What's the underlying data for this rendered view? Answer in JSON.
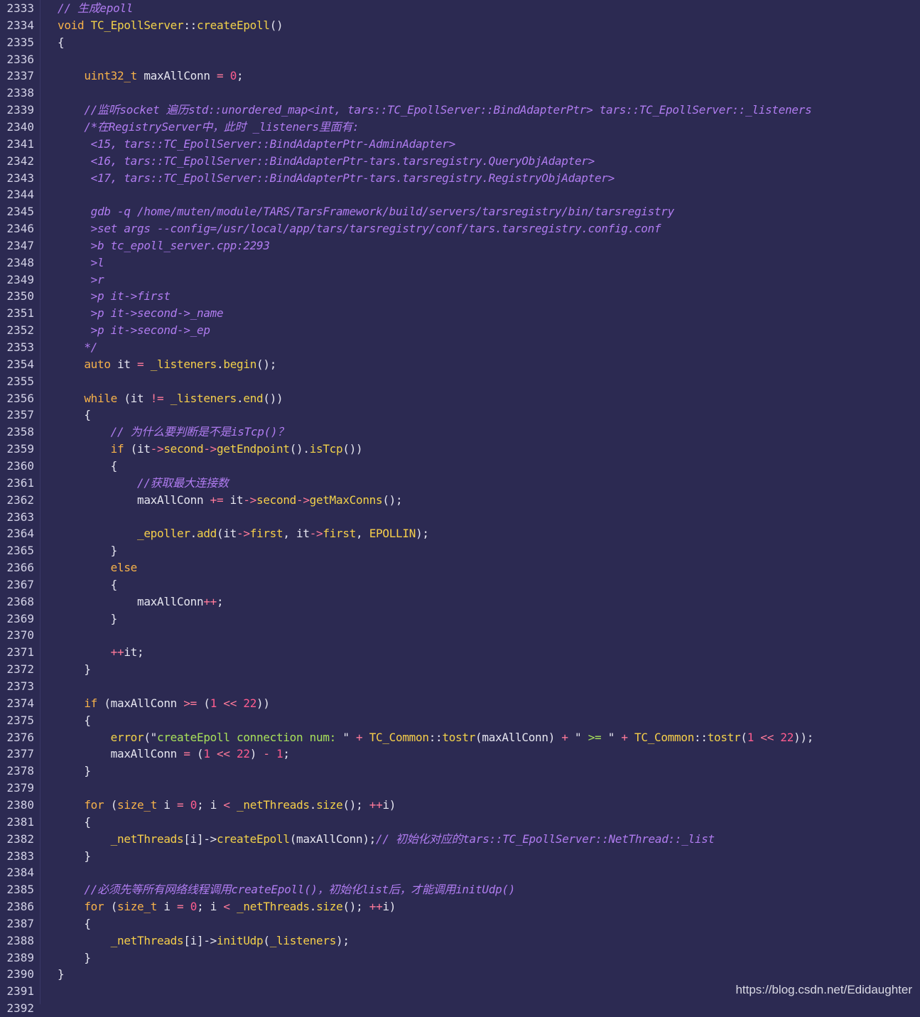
{
  "editor": {
    "lines": [
      {
        "num": "2333",
        "tokens": [
          [
            "cm",
            "// 生成epoll"
          ]
        ]
      },
      {
        "num": "2334",
        "tokens": [
          [
            "kw",
            "void "
          ],
          [
            "fn",
            "TC_EpollServer"
          ],
          [
            "pl",
            "::"
          ],
          [
            "fn",
            "createEpoll"
          ],
          [
            "pl",
            "()"
          ]
        ]
      },
      {
        "num": "2335",
        "tokens": [
          [
            "pl",
            "{"
          ]
        ]
      },
      {
        "num": "2336",
        "tokens": []
      },
      {
        "num": "2337",
        "tokens": [
          [
            "pl",
            "    "
          ],
          [
            "ty",
            "uint32_t "
          ],
          [
            "pl",
            "maxAllConn "
          ],
          [
            "op",
            "= "
          ],
          [
            "num",
            "0"
          ],
          [
            "pl",
            ";"
          ]
        ]
      },
      {
        "num": "2338",
        "tokens": []
      },
      {
        "num": "2339",
        "tokens": [
          [
            "pl",
            "    "
          ],
          [
            "cm",
            "//监听socket 遍历std::unordered_map<int, tars::TC_EpollServer::BindAdapterPtr> tars::TC_EpollServer::_listeners"
          ]
        ]
      },
      {
        "num": "2340",
        "tokens": [
          [
            "pl",
            "    "
          ],
          [
            "cm",
            "/*在RegistryServer中，此时 _listeners里面有:"
          ]
        ]
      },
      {
        "num": "2341",
        "tokens": [
          [
            "cm",
            "     <15, tars::TC_EpollServer::BindAdapterPtr-AdminAdapter>"
          ]
        ]
      },
      {
        "num": "2342",
        "tokens": [
          [
            "cm",
            "     <16, tars::TC_EpollServer::BindAdapterPtr-tars.tarsregistry.QueryObjAdapter>"
          ]
        ]
      },
      {
        "num": "2343",
        "tokens": [
          [
            "cm",
            "     <17, tars::TC_EpollServer::BindAdapterPtr-tars.tarsregistry.RegistryObjAdapter>"
          ]
        ]
      },
      {
        "num": "2344",
        "tokens": []
      },
      {
        "num": "2345",
        "tokens": [
          [
            "cm",
            "     gdb -q /home/muten/module/TARS/TarsFramework/build/servers/tarsregistry/bin/tarsregistry"
          ]
        ]
      },
      {
        "num": "2346",
        "tokens": [
          [
            "cm",
            "     >set args --config=/usr/local/app/tars/tarsregistry/conf/tars.tarsregistry.config.conf"
          ]
        ]
      },
      {
        "num": "2347",
        "tokens": [
          [
            "cm",
            "     >b tc_epoll_server.cpp:2293"
          ]
        ]
      },
      {
        "num": "2348",
        "tokens": [
          [
            "cm",
            "     >l"
          ]
        ]
      },
      {
        "num": "2349",
        "tokens": [
          [
            "cm",
            "     >r"
          ]
        ]
      },
      {
        "num": "2350",
        "tokens": [
          [
            "cm",
            "     >p it->first"
          ]
        ]
      },
      {
        "num": "2351",
        "tokens": [
          [
            "cm",
            "     >p it->second->_name"
          ]
        ]
      },
      {
        "num": "2352",
        "tokens": [
          [
            "cm",
            "     >p it->second->_ep"
          ]
        ]
      },
      {
        "num": "2353",
        "tokens": [
          [
            "cm",
            "    */"
          ]
        ]
      },
      {
        "num": "2354",
        "tokens": [
          [
            "pl",
            "    "
          ],
          [
            "kw",
            "auto "
          ],
          [
            "pl",
            "it "
          ],
          [
            "op",
            "= "
          ],
          [
            "id",
            "_listeners"
          ],
          [
            "pl",
            "."
          ],
          [
            "fn",
            "begin"
          ],
          [
            "pl",
            "();"
          ]
        ]
      },
      {
        "num": "2355",
        "tokens": []
      },
      {
        "num": "2356",
        "tokens": [
          [
            "pl",
            "    "
          ],
          [
            "kw",
            "while "
          ],
          [
            "pl",
            "(it "
          ],
          [
            "op",
            "!= "
          ],
          [
            "id",
            "_listeners"
          ],
          [
            "pl",
            "."
          ],
          [
            "fn",
            "end"
          ],
          [
            "pl",
            "())"
          ]
        ]
      },
      {
        "num": "2357",
        "tokens": [
          [
            "pl",
            "    {"
          ]
        ]
      },
      {
        "num": "2358",
        "tokens": [
          [
            "pl",
            "        "
          ],
          [
            "cm",
            "// 为什么要判断是不是isTcp()？"
          ]
        ]
      },
      {
        "num": "2359",
        "tokens": [
          [
            "pl",
            "        "
          ],
          [
            "kw",
            "if "
          ],
          [
            "pl",
            "(it"
          ],
          [
            "op",
            "->"
          ],
          [
            "id",
            "second"
          ],
          [
            "op",
            "->"
          ],
          [
            "fn",
            "getEndpoint"
          ],
          [
            "pl",
            "()."
          ],
          [
            "fn",
            "isTcp"
          ],
          [
            "pl",
            "())"
          ]
        ]
      },
      {
        "num": "2360",
        "tokens": [
          [
            "pl",
            "        {"
          ]
        ]
      },
      {
        "num": "2361",
        "tokens": [
          [
            "pl",
            "            "
          ],
          [
            "cm",
            "//获取最大连接数"
          ]
        ]
      },
      {
        "num": "2362",
        "tokens": [
          [
            "pl",
            "            maxAllConn "
          ],
          [
            "op",
            "+= "
          ],
          [
            "pl",
            "it"
          ],
          [
            "op",
            "->"
          ],
          [
            "id",
            "second"
          ],
          [
            "op",
            "->"
          ],
          [
            "fn",
            "getMaxConns"
          ],
          [
            "pl",
            "();"
          ]
        ]
      },
      {
        "num": "2363",
        "tokens": []
      },
      {
        "num": "2364",
        "tokens": [
          [
            "pl",
            "            "
          ],
          [
            "id",
            "_epoller"
          ],
          [
            "pl",
            "."
          ],
          [
            "fn",
            "add"
          ],
          [
            "pl",
            "(it"
          ],
          [
            "op",
            "->"
          ],
          [
            "id",
            "first"
          ],
          [
            "pl",
            ", it"
          ],
          [
            "op",
            "->"
          ],
          [
            "id",
            "first"
          ],
          [
            "pl",
            ", "
          ],
          [
            "id",
            "EPOLLIN"
          ],
          [
            "pl",
            ");"
          ]
        ]
      },
      {
        "num": "2365",
        "tokens": [
          [
            "pl",
            "        }"
          ]
        ]
      },
      {
        "num": "2366",
        "tokens": [
          [
            "pl",
            "        "
          ],
          [
            "kw",
            "else"
          ]
        ]
      },
      {
        "num": "2367",
        "tokens": [
          [
            "pl",
            "        {"
          ]
        ]
      },
      {
        "num": "2368",
        "tokens": [
          [
            "pl",
            "            maxAllConn"
          ],
          [
            "op",
            "++"
          ],
          [
            "pl",
            ";"
          ]
        ]
      },
      {
        "num": "2369",
        "tokens": [
          [
            "pl",
            "        }"
          ]
        ]
      },
      {
        "num": "2370",
        "tokens": []
      },
      {
        "num": "2371",
        "tokens": [
          [
            "pl",
            "        "
          ],
          [
            "op",
            "++"
          ],
          [
            "pl",
            "it;"
          ]
        ]
      },
      {
        "num": "2372",
        "tokens": [
          [
            "pl",
            "    }"
          ]
        ]
      },
      {
        "num": "2373",
        "tokens": []
      },
      {
        "num": "2374",
        "tokens": [
          [
            "pl",
            "    "
          ],
          [
            "kw",
            "if "
          ],
          [
            "pl",
            "(maxAllConn "
          ],
          [
            "op",
            ">= "
          ],
          [
            "pl",
            "("
          ],
          [
            "num",
            "1 "
          ],
          [
            "op",
            "<< "
          ],
          [
            "num",
            "22"
          ],
          [
            "pl",
            "))"
          ]
        ]
      },
      {
        "num": "2375",
        "tokens": [
          [
            "pl",
            "    {"
          ]
        ]
      },
      {
        "num": "2376",
        "tokens": [
          [
            "pl",
            "        "
          ],
          [
            "fn",
            "error"
          ],
          [
            "pl",
            "(\""
          ],
          [
            "str",
            "createEpoll connection num: "
          ],
          [
            "pl",
            "\" "
          ],
          [
            "op",
            "+ "
          ],
          [
            "id",
            "TC_Common"
          ],
          [
            "pl",
            "::"
          ],
          [
            "fn",
            "tostr"
          ],
          [
            "pl",
            "(maxAllConn) "
          ],
          [
            "op",
            "+ "
          ],
          [
            "pl",
            "\" "
          ],
          [
            "str",
            ">= "
          ],
          [
            "pl",
            "\" "
          ],
          [
            "op",
            "+ "
          ],
          [
            "id",
            "TC_Common"
          ],
          [
            "pl",
            "::"
          ],
          [
            "fn",
            "tostr"
          ],
          [
            "pl",
            "("
          ],
          [
            "num",
            "1 "
          ],
          [
            "op",
            "<< "
          ],
          [
            "num",
            "22"
          ],
          [
            "pl",
            "));"
          ]
        ]
      },
      {
        "num": "2377",
        "tokens": [
          [
            "pl",
            "        maxAllConn "
          ],
          [
            "op",
            "= "
          ],
          [
            "pl",
            "("
          ],
          [
            "num",
            "1 "
          ],
          [
            "op",
            "<< "
          ],
          [
            "num",
            "22"
          ],
          [
            "pl",
            ") "
          ],
          [
            "op",
            "- "
          ],
          [
            "num",
            "1"
          ],
          [
            "pl",
            ";"
          ]
        ]
      },
      {
        "num": "2378",
        "tokens": [
          [
            "pl",
            "    }"
          ]
        ]
      },
      {
        "num": "2379",
        "tokens": []
      },
      {
        "num": "2380",
        "tokens": [
          [
            "pl",
            "    "
          ],
          [
            "kw",
            "for "
          ],
          [
            "pl",
            "("
          ],
          [
            "ty",
            "size_t "
          ],
          [
            "pl",
            "i "
          ],
          [
            "op",
            "= "
          ],
          [
            "num",
            "0"
          ],
          [
            "pl",
            "; i "
          ],
          [
            "op",
            "< "
          ],
          [
            "id",
            "_netThreads"
          ],
          [
            "pl",
            "."
          ],
          [
            "fn",
            "size"
          ],
          [
            "pl",
            "(); "
          ],
          [
            "op",
            "++"
          ],
          [
            "pl",
            "i)"
          ]
        ]
      },
      {
        "num": "2381",
        "tokens": [
          [
            "pl",
            "    {"
          ]
        ]
      },
      {
        "num": "2382",
        "tokens": [
          [
            "pl",
            "        "
          ],
          [
            "id",
            "_netThreads"
          ],
          [
            "pl",
            "[i]->"
          ],
          [
            "fn",
            "createEpoll"
          ],
          [
            "pl",
            "(maxAllConn);"
          ],
          [
            "cm",
            "// 初始化对应的tars::TC_EpollServer::NetThread::_list"
          ]
        ]
      },
      {
        "num": "2383",
        "tokens": [
          [
            "pl",
            "    }"
          ]
        ]
      },
      {
        "num": "2384",
        "tokens": []
      },
      {
        "num": "2385",
        "tokens": [
          [
            "pl",
            "    "
          ],
          [
            "cm",
            "//必须先等所有网络线程调用createEpoll()，初始化list后，才能调用initUdp()"
          ]
        ]
      },
      {
        "num": "2386",
        "tokens": [
          [
            "pl",
            "    "
          ],
          [
            "kw",
            "for "
          ],
          [
            "pl",
            "("
          ],
          [
            "ty",
            "size_t "
          ],
          [
            "pl",
            "i "
          ],
          [
            "op",
            "= "
          ],
          [
            "num",
            "0"
          ],
          [
            "pl",
            "; i "
          ],
          [
            "op",
            "< "
          ],
          [
            "id",
            "_netThreads"
          ],
          [
            "pl",
            "."
          ],
          [
            "fn",
            "size"
          ],
          [
            "pl",
            "(); "
          ],
          [
            "op",
            "++"
          ],
          [
            "pl",
            "i)"
          ]
        ]
      },
      {
        "num": "2387",
        "tokens": [
          [
            "pl",
            "    {"
          ]
        ]
      },
      {
        "num": "2388",
        "tokens": [
          [
            "pl",
            "        "
          ],
          [
            "id",
            "_netThreads"
          ],
          [
            "pl",
            "[i]->"
          ],
          [
            "fn",
            "initUdp"
          ],
          [
            "pl",
            "("
          ],
          [
            "id",
            "_listeners"
          ],
          [
            "pl",
            ");"
          ]
        ]
      },
      {
        "num": "2389",
        "tokens": [
          [
            "pl",
            "    }"
          ]
        ]
      },
      {
        "num": "2390",
        "tokens": [
          [
            "pl",
            "}"
          ]
        ]
      },
      {
        "num": "2391",
        "tokens": []
      },
      {
        "num": "2392",
        "tokens": []
      }
    ]
  },
  "watermark": "https://blog.csdn.net/Edidaughter",
  "colors": {
    "background": "#2c2a52",
    "comment": "#b07cf0",
    "keyword": "#f7b24a",
    "function": "#f2d24a",
    "number": "#ff5d8f",
    "string": "#a8e05a"
  }
}
